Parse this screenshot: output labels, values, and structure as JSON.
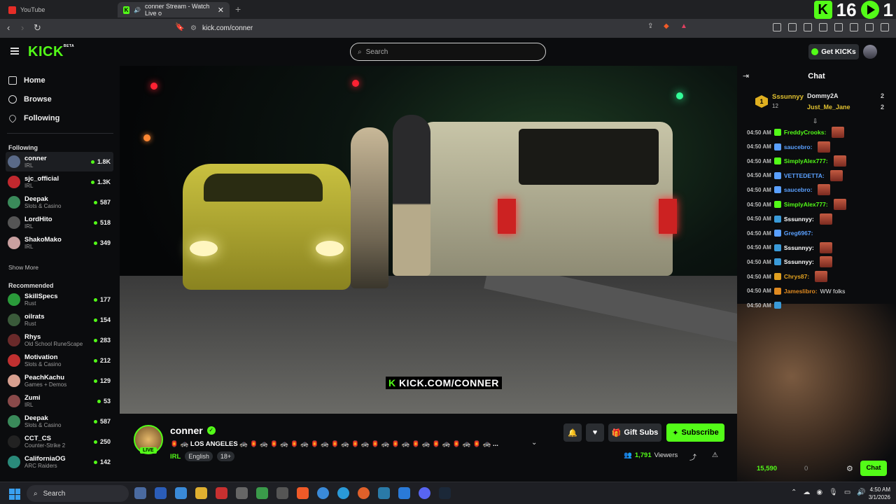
{
  "browser": {
    "tabs": [
      {
        "label": "YouTube",
        "icon": "youtube-icon"
      },
      {
        "label": "conner Stream - Watch Live o",
        "icon": "kick-icon"
      }
    ],
    "url": "kick.com/conner",
    "overlay_score_left": "16",
    "overlay_score_right": "1"
  },
  "header": {
    "logo": "KICK",
    "logo_badge": "BETA",
    "search_placeholder": "Search",
    "get_kicks": "Get KICKs"
  },
  "sidebar": {
    "nav": [
      {
        "label": "Home",
        "icon": "home-icon"
      },
      {
        "label": "Browse",
        "icon": "compass-icon"
      },
      {
        "label": "Following",
        "icon": "heart-icon"
      }
    ],
    "following_title": "Following",
    "following": [
      {
        "name": "conner",
        "category": "IRL",
        "viewers": "1.8K",
        "color": "#5a6a88"
      },
      {
        "name": "sjc_official",
        "category": "IRL",
        "viewers": "1.3K",
        "color": "#c0282e"
      },
      {
        "name": "Deepak",
        "category": "Slots & Casino",
        "viewers": "587",
        "color": "#3a8a5a"
      },
      {
        "name": "LordHito",
        "category": "IRL",
        "viewers": "518",
        "color": "#555"
      },
      {
        "name": "ShakoMako",
        "category": "IRL",
        "viewers": "349",
        "color": "#c9a0a0"
      }
    ],
    "show_more": "Show More",
    "recommended_title": "Recommended",
    "recommended": [
      {
        "name": "SkillSpecs",
        "category": "Rust",
        "viewers": "177",
        "color": "#2a9a3a"
      },
      {
        "name": "oilrats",
        "category": "Rust",
        "viewers": "154",
        "color": "#3a5a3a"
      },
      {
        "name": "Rhys",
        "category": "Old School RuneScape",
        "viewers": "283",
        "color": "#6a2a2a"
      },
      {
        "name": "Motivation",
        "category": "Slots & Casino",
        "viewers": "212",
        "color": "#c03030"
      },
      {
        "name": "PeachKachu",
        "category": "Games + Demos",
        "viewers": "129",
        "color": "#d8a090"
      },
      {
        "name": "Zumi",
        "category": "IRL",
        "viewers": "53",
        "color": "#8a4a4a"
      },
      {
        "name": "Deepak",
        "category": "Slots & Casino",
        "viewers": "587",
        "color": "#3a8a5a"
      },
      {
        "name": "CCT_CS",
        "category": "Counter-Strike 2",
        "viewers": "250",
        "color": "#222"
      },
      {
        "name": "CaliforniaOG",
        "category": "ARC Raiders",
        "viewers": "142",
        "color": "#2a8a7a"
      }
    ]
  },
  "video": {
    "watermark_k": "K",
    "watermark": "KICK.COM/CONNER"
  },
  "stream": {
    "name": "conner",
    "live": "LIVE",
    "title": "🏮 🚓 LOS ANGELES 🚓 🏮 🚓 🏮 🚓 🏮 🚓 🏮 🚓 🏮 🚓 🏮 🚓 🏮 🚓 🏮 🚓 🏮 🚓 🏮 🚓 🏮 🚓 🏮 🚓 ...",
    "category": "IRL",
    "tags": [
      "English",
      "18+"
    ],
    "gift_subs": "Gift Subs",
    "subscribe": "Subscribe",
    "viewers_count": "1,791",
    "viewers_label": "Viewers"
  },
  "chat": {
    "title": "Chat",
    "leaderboard": {
      "rank": "1",
      "top_name": "Sssunnyy",
      "top_value": "12",
      "rows": [
        {
          "name": "Dommy2A",
          "count": "2",
          "color": "#ffffff"
        },
        {
          "name": "Just_Me_Jane",
          "count": "2",
          "color": "#e0c030"
        }
      ]
    },
    "messages": [
      {
        "time": "04:50 AM",
        "user": "FreddyCrooks:",
        "color": "#53fc18",
        "text": "",
        "emote": true
      },
      {
        "time": "04:50 AM",
        "user": "saucebro:",
        "color": "#5aa0ff",
        "text": "",
        "emote": true
      },
      {
        "time": "04:50 AM",
        "user": "SimplyAlex777:",
        "color": "#53fc18",
        "text": "",
        "emote": true
      },
      {
        "time": "04:50 AM",
        "user": "VETTEDETTA:",
        "color": "#5aa0ff",
        "text": "",
        "emote": true
      },
      {
        "time": "04:50 AM",
        "user": "saucebro:",
        "color": "#5aa0ff",
        "text": "",
        "emote": true
      },
      {
        "time": "04:50 AM",
        "user": "SimplyAlex777:",
        "color": "#53fc18",
        "text": "",
        "emote": true
      },
      {
        "time": "04:50 AM",
        "user": "Sssunnyy:",
        "color": "#ffffff",
        "text": "",
        "emote": true
      },
      {
        "time": "04:50 AM",
        "user": "Greg6967:",
        "color": "#5aa0ff",
        "text": "",
        "emote": false
      },
      {
        "time": "04:50 AM",
        "user": "Sssunnyy:",
        "color": "#ffffff",
        "text": "",
        "emote": true
      },
      {
        "time": "04:50 AM",
        "user": "Sssunnyy:",
        "color": "#ffffff",
        "text": "",
        "emote": true
      },
      {
        "time": "04:50 AM",
        "user": "Chrys87:",
        "color": "#e0a020",
        "text": "",
        "emote": true
      },
      {
        "time": "04:50 AM",
        "user": "Jameslibro:",
        "color": "#e08a20",
        "text": "WW folks",
        "emote": false
      },
      {
        "time": "04:50 AM",
        "user": "",
        "color": "#ffffff",
        "text": "",
        "emote": false
      }
    ],
    "points": "15,590",
    "points_secondary": "0",
    "chat_button": "Chat"
  },
  "taskbar": {
    "search": "Search",
    "time": "4:50 AM",
    "date": "3/1/2026"
  }
}
